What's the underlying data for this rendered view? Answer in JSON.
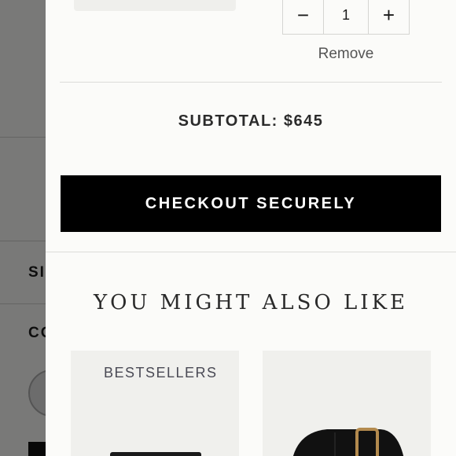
{
  "background_page": {
    "size_label_partial": "SIZ",
    "color_label_partial": "CO"
  },
  "cart": {
    "quantity": {
      "minus_label": "−",
      "value": "1",
      "plus_label": "+"
    },
    "remove_label": "Remove",
    "subtotal_text": "SUBTOTAL: $645",
    "checkout_label": "CHECKOUT SECURELY"
  },
  "recommendations": {
    "title": "YOU MIGHT ALSO LIKE",
    "products": [
      {
        "badge": "BESTSELLERS",
        "image": "black-leather-bracelet"
      },
      {
        "badge": "",
        "image": "black-leather-watch-strap-gold-buckle"
      }
    ]
  },
  "colors": {
    "drawer_bg": "#fbfbf9",
    "button_bg": "#000000",
    "overlay": "#7a7a7a",
    "accent_gold": "#b38a4e"
  }
}
